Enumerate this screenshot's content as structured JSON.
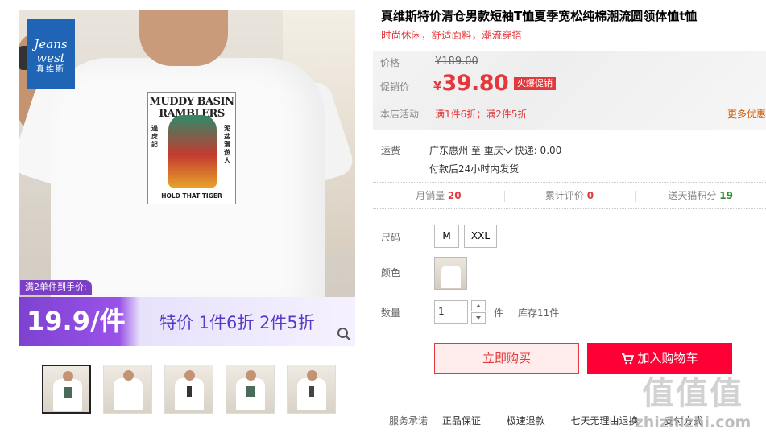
{
  "brand": {
    "name_en_1": "Jeans",
    "name_en_2": "west",
    "name_cn": "真维斯"
  },
  "product_image": {
    "print_title": "MUDDY BASIN RAMBLERS",
    "print_subtitle": "HOLD THAT TIGER",
    "print_side_left": "過虎記",
    "print_side_right": "泥盆漫遊人"
  },
  "promo": {
    "tag": "满2单件到手价:",
    "price": "19.9/件",
    "text": "特价 1件6折 2件5折"
  },
  "title": "真维斯特价清仓男款短袖T恤夏季宽松纯棉潮流圆领体恤t恤",
  "subtitle": "时尚休闲，舒适面料，潮流穿搭",
  "pricing": {
    "original_label": "价格",
    "original_price": "¥189.00",
    "promo_label": "促销价",
    "currency": "¥",
    "current_price": "39.80",
    "badge": "火爆促销",
    "activity_label": "本店活动",
    "activity_text": "满1件6折；满2件5折",
    "more_link": "更多优惠"
  },
  "shipping": {
    "label": "运费",
    "from": "广东惠州",
    "to_word": "至",
    "destination": "重庆",
    "express": "快递: 0.00",
    "note": "付款后24小时内发货"
  },
  "stats": {
    "monthly_sales_label": "月销量",
    "monthly_sales_value": "20",
    "reviews_label": "累计评价",
    "reviews_value": "0",
    "points_label": "送天猫积分",
    "points_value": "19"
  },
  "options": {
    "size_label": "尺码",
    "sizes": [
      "M",
      "XXL"
    ],
    "color_label": "颜色",
    "quantity_label": "数量",
    "quantity_value": "1",
    "quantity_unit": "件",
    "stock": "库存11件"
  },
  "actions": {
    "buy_now": "立即购买",
    "add_to_cart": "加入购物车"
  },
  "promise": {
    "label": "服务承诺",
    "items": [
      "正品保证",
      "极速退款",
      "七天无理由退换",
      "支付方式"
    ]
  },
  "watermark": {
    "big": "值值值",
    "small": "zhizhizhi.com"
  },
  "colors": {
    "accent": "#e4393c",
    "cart": "#ff0036",
    "promo_purple": "#7d42d0",
    "brand_blue": "#1f64b5"
  }
}
